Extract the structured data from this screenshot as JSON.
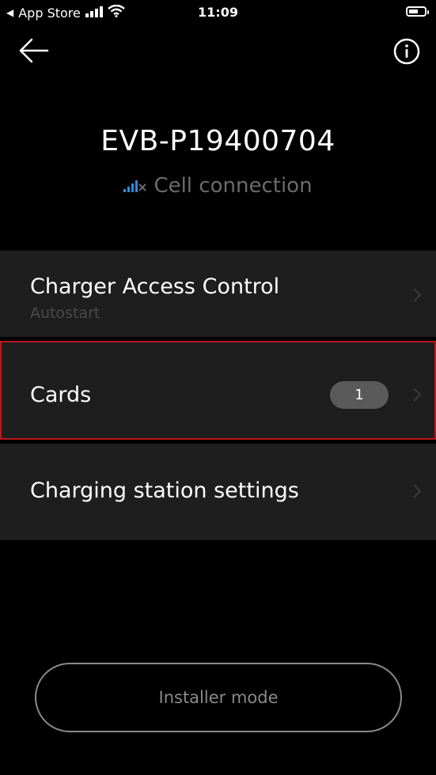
{
  "status_bar": {
    "back_app": "App Store",
    "time": "11:09",
    "battery_level": 0.6
  },
  "header": {
    "back_icon": "arrow-left-icon",
    "info_icon": "info-circle-icon"
  },
  "charger": {
    "name": "EVB-P19400704",
    "connection_icon": "cell-signal-off-icon",
    "connection_label": "Cell connection",
    "connection_icon_color": "#2a8fd6"
  },
  "menu": {
    "access_control": {
      "label": "Charger Access Control",
      "sublabel": "Autostart"
    },
    "cards": {
      "label": "Cards",
      "count": "1",
      "highlight_color": "#c0161b"
    },
    "station_settings": {
      "label": "Charging station settings"
    }
  },
  "footer": {
    "installer_label": "Installer mode"
  }
}
